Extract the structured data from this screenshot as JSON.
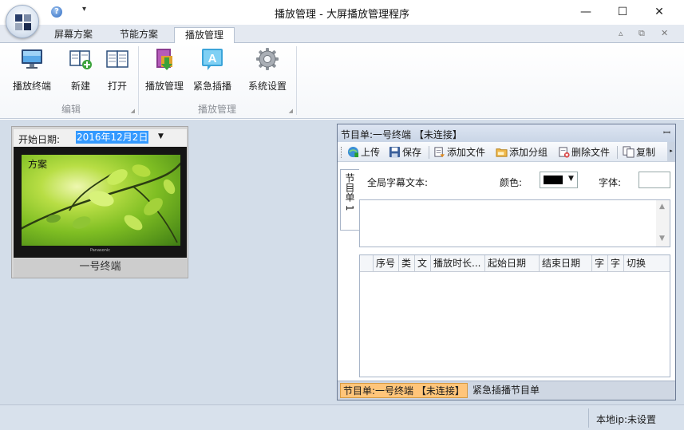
{
  "window": {
    "title": "播放管理 - 大屏播放管理程序",
    "help_icon": "?",
    "qat_more_icon": "▾",
    "minimize": "—",
    "maximize": "☐",
    "close": "✕"
  },
  "ribbon": {
    "tabs": [
      {
        "label": "屏幕方案"
      },
      {
        "label": "节能方案"
      },
      {
        "label": "播放管理"
      }
    ],
    "active_tab": "播放管理",
    "mdi_buttons": [
      "▵",
      "⧉",
      "✕"
    ],
    "groups": [
      {
        "label": "编辑",
        "buttons": [
          {
            "label": "播放终端",
            "icon": "monitor-icon"
          },
          {
            "label": "新建",
            "icon": "new-book-icon"
          },
          {
            "label": "打开",
            "icon": "open-book-icon"
          }
        ]
      },
      {
        "label": "播放管理",
        "buttons": [
          {
            "label": "播放管理",
            "icon": "playlist-book-icon"
          },
          {
            "label": "紧急插播",
            "icon": "urgent-text-icon"
          },
          {
            "label": "系统设置",
            "icon": "gear-icon"
          }
        ]
      }
    ]
  },
  "terminal": {
    "start_date_label": "开始日期:",
    "start_date_value": "2016年12月2日",
    "scheme_label": "方案",
    "brand_text": "Panasonic",
    "name": "一号终端"
  },
  "panel": {
    "title": "节目单:一号终端 【未连接】",
    "pin_icon": "📌",
    "toolbar": [
      {
        "label": "上传",
        "icon": "upload-icon"
      },
      {
        "label": "保存",
        "icon": "save-icon"
      },
      {
        "label": "添加文件",
        "icon": "add-file-icon"
      },
      {
        "label": "添加分组",
        "icon": "add-group-icon"
      },
      {
        "label": "删除文件",
        "icon": "delete-file-icon"
      },
      {
        "label": "复制",
        "icon": "copy-icon"
      }
    ],
    "vertical_tab": "节目单 1",
    "global_caption_label": "全局字幕文本:",
    "color_label": "颜色:",
    "color_value": "#000000",
    "font_label": "字体:",
    "font_value": "",
    "caption_text": "",
    "table_columns": [
      "序号",
      "类",
      "文",
      "播放时长...",
      "起始日期",
      "结束日期",
      "字",
      "字",
      "切换"
    ],
    "table_rows": [],
    "bottom_tabs": [
      {
        "label": "节目单:一号终端 【未连接】"
      },
      {
        "label": "紧急插播节目单"
      }
    ]
  },
  "status": {
    "local_ip": "本地ip:未设置"
  }
}
